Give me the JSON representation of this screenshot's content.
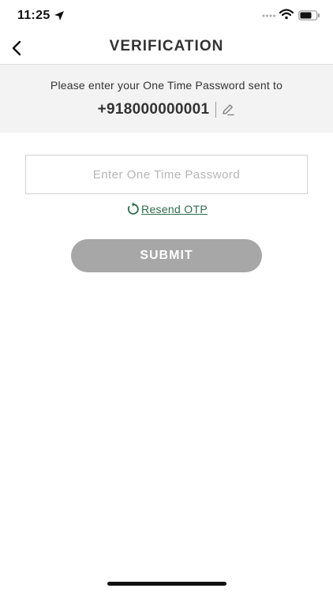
{
  "status_bar": {
    "time": "11:25"
  },
  "nav": {
    "title": "VERIFICATION"
  },
  "info": {
    "message": "Please enter your One Time Password sent to",
    "phone_number": "+918000000001"
  },
  "otp_field": {
    "placeholder": "Enter One Time Password",
    "value": ""
  },
  "resend": {
    "label": "Resend OTP"
  },
  "submit": {
    "label": "SUBMIT"
  },
  "colors": {
    "accent_green": "#2e6b4a",
    "submit_bg": "#a7a7a7",
    "panel_bg": "#f3f3f3"
  }
}
